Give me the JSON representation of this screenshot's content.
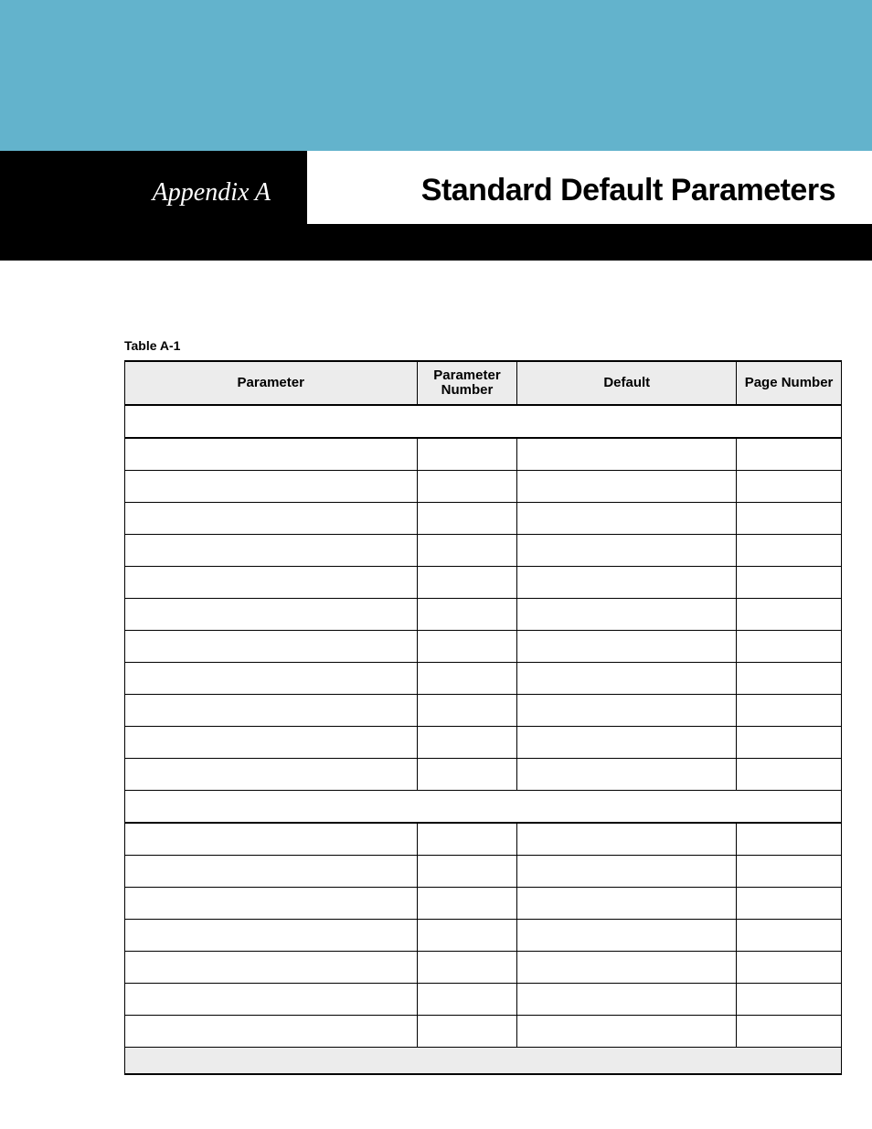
{
  "header": {
    "appendix": "Appendix A",
    "title": "Standard Default Parameters"
  },
  "table": {
    "caption": "Table A-1",
    "columns": [
      "Parameter",
      "Parameter Number",
      "Default",
      "Page Number"
    ],
    "sections": [
      {
        "title": "",
        "rows": [
          {
            "parameter": "",
            "number": "",
            "default": "",
            "page": ""
          },
          {
            "parameter": "",
            "number": "",
            "default": "",
            "page": ""
          },
          {
            "parameter": "",
            "number": "",
            "default": "",
            "page": ""
          },
          {
            "parameter": "",
            "number": "",
            "default": "",
            "page": ""
          },
          {
            "parameter": "",
            "number": "",
            "default": "",
            "page": ""
          },
          {
            "parameter": "",
            "number": "",
            "default": "",
            "page": ""
          },
          {
            "parameter": "",
            "number": "",
            "default": "",
            "page": ""
          },
          {
            "parameter": "",
            "number": "",
            "default": "",
            "page": ""
          },
          {
            "parameter": "",
            "number": "",
            "default": "",
            "page": ""
          },
          {
            "parameter": "",
            "number": "",
            "default": "",
            "page": ""
          },
          {
            "parameter": "",
            "number": "",
            "default": "",
            "page": ""
          }
        ]
      },
      {
        "title": "",
        "rows": [
          {
            "parameter": "",
            "number": "",
            "default": "",
            "page": ""
          },
          {
            "parameter": "",
            "number": "",
            "default": "",
            "page": ""
          },
          {
            "parameter": "",
            "number": "",
            "default": "",
            "page": ""
          },
          {
            "parameter": "",
            "number": "",
            "default": "",
            "page": ""
          },
          {
            "parameter": "",
            "number": "",
            "default": "",
            "page": ""
          },
          {
            "parameter": "",
            "number": "",
            "default": "",
            "page": ""
          },
          {
            "parameter": "",
            "number": "",
            "default": "",
            "page": ""
          }
        ]
      }
    ],
    "footer": ""
  },
  "colors": {
    "band": "#63b3cc",
    "black": "#000000",
    "headerBg": "#ececec"
  }
}
